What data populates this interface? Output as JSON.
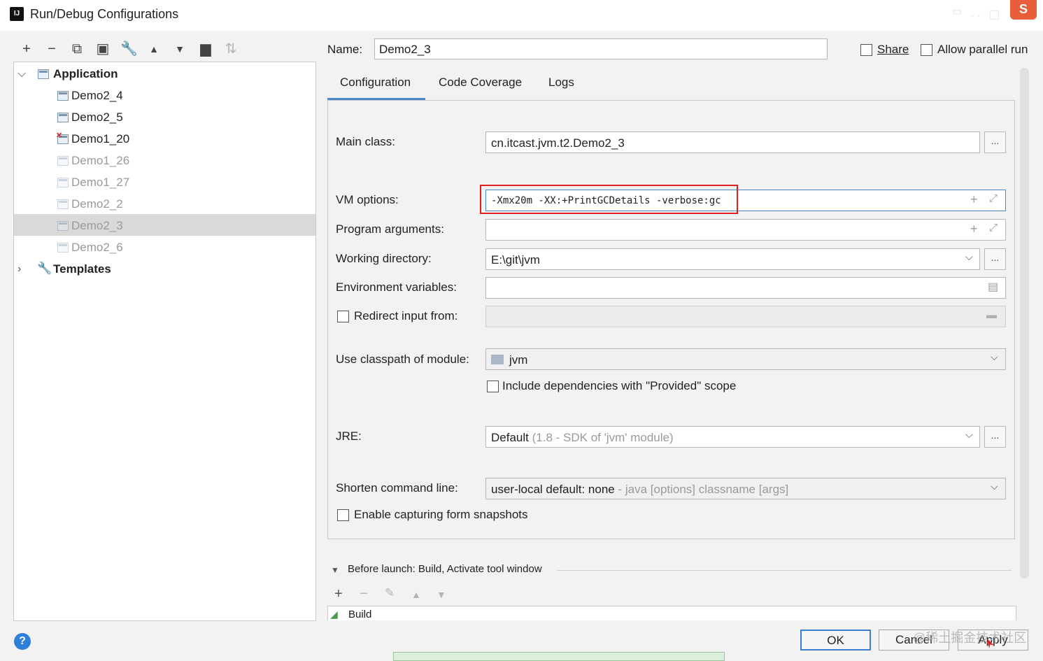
{
  "window": {
    "title": "Run/Debug Configurations",
    "app_icon": "IJ",
    "corner_logo": "S",
    "corner_faded": "ᄆ ·· ☐"
  },
  "toolbar": {
    "icons": [
      "add-icon",
      "remove-icon",
      "copy-icon",
      "save-icon",
      "wrench-icon",
      "move-up-icon",
      "move-down-icon",
      "folder-icon",
      "sort-icon"
    ]
  },
  "tree": {
    "application_label": "Application",
    "items": [
      {
        "label": "Demo2_4",
        "dim": false
      },
      {
        "label": "Demo2_5",
        "dim": false
      },
      {
        "label": "Demo1_20",
        "dim": false,
        "error": true
      },
      {
        "label": "Demo1_26",
        "dim": true
      },
      {
        "label": "Demo1_27",
        "dim": true
      },
      {
        "label": "Demo2_2",
        "dim": true
      },
      {
        "label": "Demo2_3",
        "dim": true,
        "selected": true
      },
      {
        "label": "Demo2_6",
        "dim": true
      }
    ],
    "templates_label": "Templates"
  },
  "name": {
    "label": "Name:",
    "value": "Demo2_3"
  },
  "share": {
    "label": "Share",
    "checked": false
  },
  "parallel": {
    "label": "Allow parallel run",
    "checked": false
  },
  "tabs": [
    {
      "label": "Configuration",
      "active": true
    },
    {
      "label": "Code Coverage"
    },
    {
      "label": "Logs"
    }
  ],
  "form": {
    "main_class": {
      "label": "Main class:",
      "value": "cn.itcast.jvm.t2.Demo2_3"
    },
    "vm_options": {
      "label": "VM options:",
      "value": "-Xmx20m -XX:+PrintGCDetails -verbose:gc"
    },
    "program_args": {
      "label": "Program arguments:",
      "value": ""
    },
    "working_dir": {
      "label": "Working directory:",
      "value": "E:\\git\\jvm"
    },
    "env_vars": {
      "label": "Environment variables:",
      "value": ""
    },
    "redirect": {
      "label": "Redirect input from:",
      "checked": false
    },
    "classpath": {
      "label": "Use classpath of module:",
      "value": "jvm"
    },
    "include_deps": {
      "label": "Include dependencies with \"Provided\" scope",
      "checked": false
    },
    "jre": {
      "label": "JRE:",
      "value": "Default",
      "hint": "(1.8 - SDK of 'jvm' module)"
    },
    "shorten": {
      "label": "Shorten command line:",
      "value": "user-local default: none",
      "hint": "- java [options] classname [args]"
    },
    "snapshots": {
      "label": "Enable capturing form snapshots",
      "checked": false
    },
    "dots": "..."
  },
  "before_launch": {
    "label": "Before launch: Build, Activate tool window",
    "item": "Build"
  },
  "buttons": {
    "help": "?",
    "ok": "OK",
    "cancel": "Cancel",
    "apply": "Apply"
  },
  "watermark": "@稀土掘金技术社区",
  "colors": {
    "accent": "#4a88c7",
    "highlight_box": "#e02020",
    "selection": "#d9d9d9"
  }
}
